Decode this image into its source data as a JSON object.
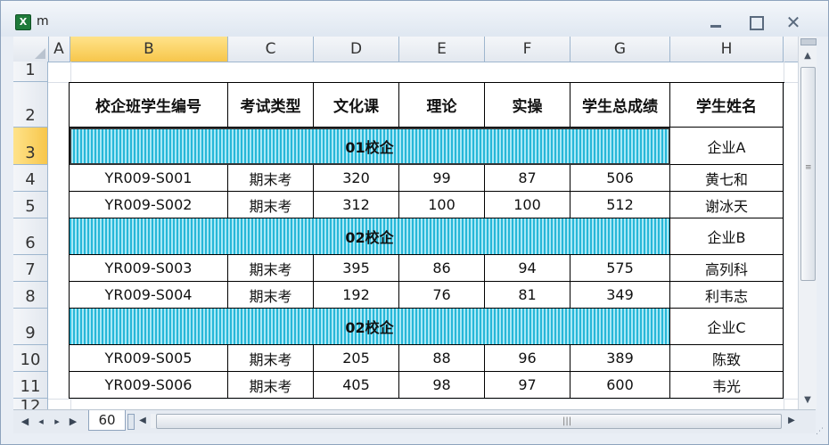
{
  "window": {
    "title": "m",
    "app_icon": "excel-icon",
    "min_icon": "minimize-icon",
    "max_icon": "maximize-icon",
    "close_icon": "close-icon"
  },
  "columns": [
    "A",
    "B",
    "C",
    "D",
    "E",
    "F",
    "G",
    "H"
  ],
  "active_column": "B",
  "rows": [
    "1",
    "2",
    "3",
    "4",
    "5",
    "6",
    "7",
    "8",
    "9",
    "10",
    "11",
    "12"
  ],
  "active_row": "3",
  "table": {
    "headers": [
      "校企班学生编号",
      "考试类型",
      "文化课",
      "理论",
      "实操",
      "学生总成绩",
      "学生姓名"
    ],
    "band1": {
      "label": "01校企",
      "name": "企业A"
    },
    "band2": {
      "label": "02校企",
      "name": "企业B"
    },
    "band3": {
      "label": "02校企",
      "name": "企业C"
    },
    "records": [
      {
        "id": "YR009-S001",
        "type": "期末考",
        "culture": "320",
        "theory": "99",
        "practice": "87",
        "total": "506",
        "name": "黄七和"
      },
      {
        "id": "YR009-S002",
        "type": "期末考",
        "culture": "312",
        "theory": "100",
        "practice": "100",
        "total": "512",
        "name": "谢冰天"
      },
      {
        "id": "YR009-S003",
        "type": "期末考",
        "culture": "395",
        "theory": "86",
        "practice": "94",
        "total": "575",
        "name": "高列科"
      },
      {
        "id": "YR009-S004",
        "type": "期末考",
        "culture": "192",
        "theory": "76",
        "practice": "81",
        "total": "349",
        "name": "利韦志"
      },
      {
        "id": "YR009-S005",
        "type": "期末考",
        "culture": "205",
        "theory": "88",
        "practice": "96",
        "total": "389",
        "name": "陈致"
      },
      {
        "id": "YR009-S006",
        "type": "期末考",
        "culture": "405",
        "theory": "98",
        "practice": "97",
        "total": "600",
        "name": "韦光"
      }
    ]
  },
  "sheet_tab": {
    "label": "60"
  },
  "nav": {
    "first": "◀",
    "prev": "◂",
    "next": "▸",
    "last": "▶"
  },
  "colors": {
    "band_dark": "#27b7d8",
    "band_light": "#a9e8f6",
    "active_header": "#f7c64b"
  }
}
